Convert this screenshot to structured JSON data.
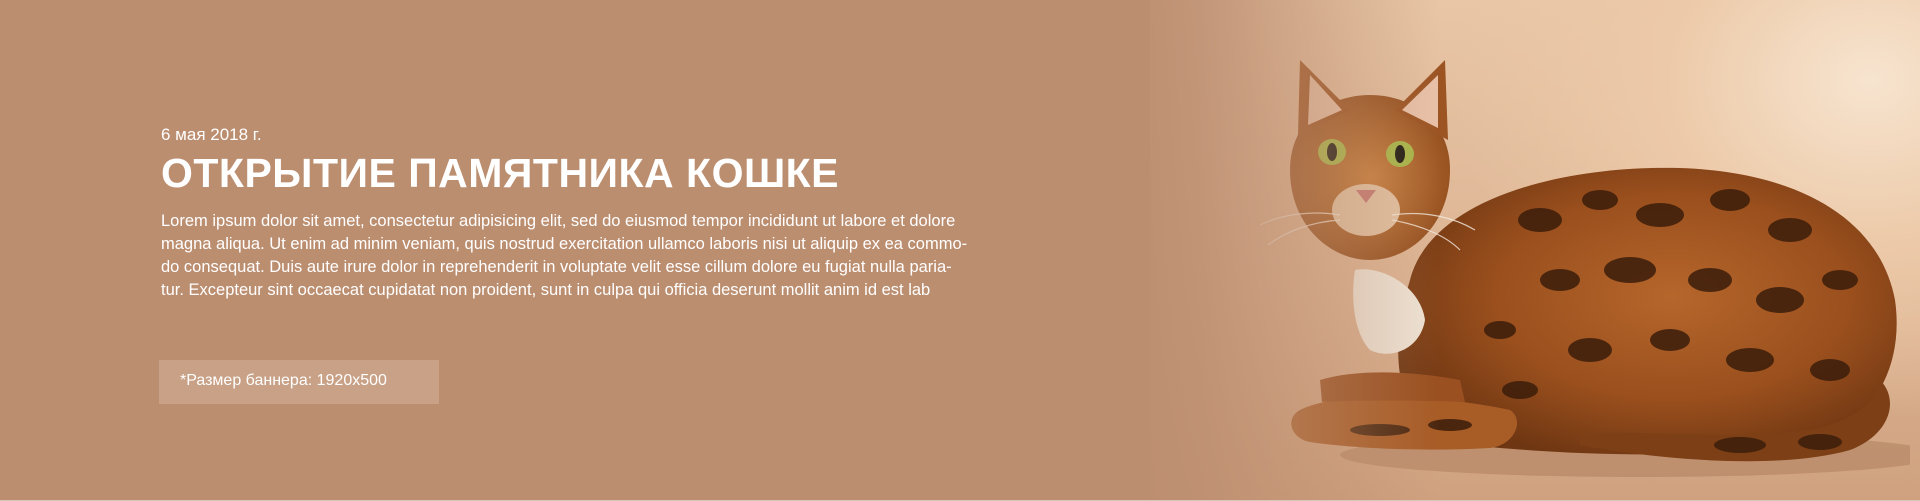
{
  "banner": {
    "date": "6 мая 2018 г.",
    "title": "ОТКРЫТИЕ ПАМЯТНИКА КОШКЕ",
    "text_lines": [
      "Lorem ipsum dolor sit amet, consectetur adipisicing elit, sed do eiusmod tempor incididunt ut labore et dolore",
      "magna aliqua. Ut enim ad minim veniam, quis nostrud exercitation ullamco laboris nisi ut aliquip ex ea commo-",
      "do consequat. Duis aute irure dolor in reprehenderit in voluptate velit esse cillum dolore eu fugiat nulla paria-",
      "tur. Excepteur sint occaecat cupidatat non proident, sunt in culpa qui officia deserunt mollit anim id est lab"
    ],
    "size_note": "*Размер баннера: 1920x500",
    "image": "bengal-cat-photo"
  },
  "colors": {
    "background": "#bc8e70",
    "badge": "#c8a186",
    "text": "#ffffff"
  }
}
